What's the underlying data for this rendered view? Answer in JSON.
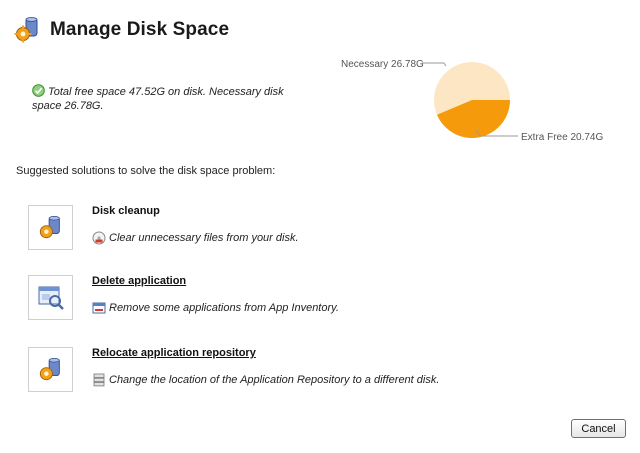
{
  "header": {
    "title": "Manage Disk Space",
    "icon": "disk-gear-icon"
  },
  "summary": {
    "text": "Total free space 47.52G on disk. Necessary disk space 26.78G.",
    "icon": "check-icon"
  },
  "chart_data": {
    "type": "pie",
    "slices": [
      {
        "label": "Necessary 26.78G",
        "value": 26.78,
        "color": "#fde6c4"
      },
      {
        "label": "Extra Free 20.74G",
        "value": 20.74,
        "color": "#f59a0a"
      }
    ],
    "legend": "callout-labels"
  },
  "suggestions_heading": "Suggested solutions to solve the disk space problem:",
  "solutions": [
    {
      "title": "Disk cleanup",
      "description": "Clear unnecessary files from your disk.",
      "icon": "disk-gear-icon",
      "desc_icon": "clean-disk-icon"
    },
    {
      "title": "Delete application",
      "description": "Remove some applications from App Inventory.",
      "icon": "app-window-icon",
      "desc_icon": "window-remove-icon"
    },
    {
      "title": "Relocate application repository",
      "description": "Change the location of the Application Repository to a different disk.",
      "icon": "disk-gear-icon",
      "desc_icon": "repository-icon"
    }
  ],
  "buttons": {
    "cancel": "Cancel"
  },
  "colors": {
    "necessary": "#fde6c4",
    "extra_free": "#f59a0a"
  }
}
